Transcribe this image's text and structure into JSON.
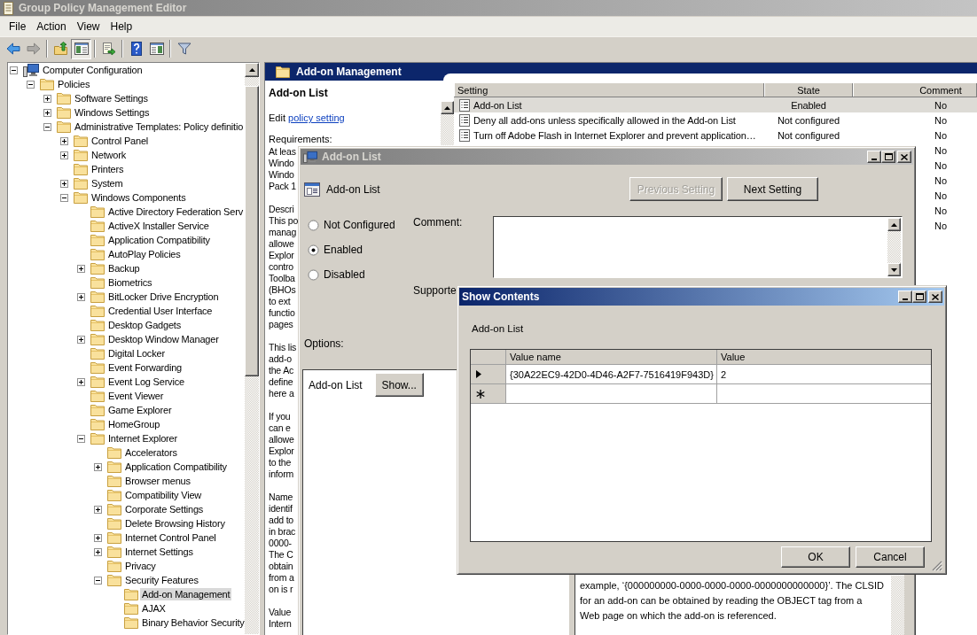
{
  "window": {
    "title": "Group Policy Management Editor",
    "active": false
  },
  "menu": [
    "File",
    "Action",
    "View",
    "Help"
  ],
  "toolbar": [
    {
      "kind": "back",
      "disabled": false,
      "pressed": false
    },
    {
      "kind": "forward",
      "disabled": true,
      "pressed": false
    },
    {
      "kind": "separator"
    },
    {
      "kind": "up",
      "disabled": false,
      "pressed": false
    },
    {
      "kind": "console_tree",
      "disabled": false,
      "pressed": true
    },
    {
      "kind": "separator"
    },
    {
      "kind": "export",
      "disabled": false,
      "pressed": false
    },
    {
      "kind": "separator"
    },
    {
      "kind": "help",
      "disabled": false,
      "pressed": false
    },
    {
      "kind": "action_pane",
      "disabled": false,
      "pressed": false
    },
    {
      "kind": "separator"
    },
    {
      "kind": "filter",
      "disabled": false,
      "pressed": false
    }
  ],
  "tree": [
    {
      "label": "Computer Configuration",
      "kind": "computer",
      "expanded": true,
      "selected": false,
      "children": [
        {
          "label": "Policies",
          "expanded": true,
          "selected": false,
          "children": [
            {
              "label": "Software Settings",
              "expanded": false,
              "selected": false
            },
            {
              "label": "Windows Settings",
              "expanded": false,
              "selected": false
            },
            {
              "label": "Administrative Templates: Policy definitio",
              "expanded": true,
              "selected": false,
              "children": [
                {
                  "label": "Control Panel",
                  "expanded": false,
                  "selected": false
                },
                {
                  "label": "Network",
                  "expanded": false,
                  "selected": false
                },
                {
                  "label": "Printers",
                  "selected": false
                },
                {
                  "label": "System",
                  "expanded": false,
                  "selected": false
                },
                {
                  "label": "Windows Components",
                  "expanded": true,
                  "selected": false,
                  "children": [
                    {
                      "label": "Active Directory Federation Serv",
                      "selected": false
                    },
                    {
                      "label": "ActiveX Installer Service",
                      "selected": false
                    },
                    {
                      "label": "Application Compatibility",
                      "selected": false
                    },
                    {
                      "label": "AutoPlay Policies",
                      "selected": false
                    },
                    {
                      "label": "Backup",
                      "expanded": false,
                      "selected": false
                    },
                    {
                      "label": "Biometrics",
                      "selected": false
                    },
                    {
                      "label": "BitLocker Drive Encryption",
                      "expanded": false,
                      "selected": false
                    },
                    {
                      "label": "Credential User Interface",
                      "selected": false
                    },
                    {
                      "label": "Desktop Gadgets",
                      "selected": false
                    },
                    {
                      "label": "Desktop Window Manager",
                      "expanded": false,
                      "selected": false
                    },
                    {
                      "label": "Digital Locker",
                      "selected": false
                    },
                    {
                      "label": "Event Forwarding",
                      "selected": false
                    },
                    {
                      "label": "Event Log Service",
                      "expanded": false,
                      "selected": false
                    },
                    {
                      "label": "Event Viewer",
                      "selected": false
                    },
                    {
                      "label": "Game Explorer",
                      "selected": false
                    },
                    {
                      "label": "HomeGroup",
                      "selected": false
                    },
                    {
                      "label": "Internet Explorer",
                      "expanded": true,
                      "selected": false,
                      "children": [
                        {
                          "label": "Accelerators",
                          "selected": false
                        },
                        {
                          "label": "Application Compatibility",
                          "expanded": false,
                          "selected": false
                        },
                        {
                          "label": "Browser menus",
                          "selected": false
                        },
                        {
                          "label": "Compatibility View",
                          "selected": false
                        },
                        {
                          "label": "Corporate Settings",
                          "expanded": false,
                          "selected": false
                        },
                        {
                          "label": "Delete Browsing History",
                          "selected": false
                        },
                        {
                          "label": "Internet Control Panel",
                          "expanded": false,
                          "selected": false
                        },
                        {
                          "label": "Internet Settings",
                          "expanded": false,
                          "selected": false
                        },
                        {
                          "label": "Privacy",
                          "selected": false
                        },
                        {
                          "label": "Security Features",
                          "expanded": true,
                          "selected": false,
                          "children": [
                            {
                              "label": "Add-on Management",
                              "selected": true
                            },
                            {
                              "label": "AJAX",
                              "selected": false
                            },
                            {
                              "label": "Binary Behavior Security",
                              "selected": false
                            }
                          ]
                        }
                      ]
                    }
                  ]
                }
              ]
            }
          ]
        }
      ]
    }
  ],
  "details": {
    "header": "Add-on Management",
    "description": {
      "title": "Add-on List",
      "edit_prefix": "Edit",
      "edit_link": "policy setting",
      "requirements_label": "Requirements:",
      "paragraphs": [
        [
          "At leas",
          "Windo",
          "Windo",
          "Pack 1"
        ],
        [
          "Descri",
          "This po",
          "manag",
          "allowe",
          "Explor",
          "contro",
          "Toolba",
          "(BHOs",
          "to ext",
          "functio",
          "pages"
        ],
        [
          "This lis",
          "add-o",
          "the Ac",
          "define",
          "here a"
        ],
        [
          "If you",
          "can e",
          "allowe",
          "Explor",
          "to the",
          "inform"
        ],
        [
          "Name",
          "identif",
          "add to",
          "in brac",
          "0000-",
          "The C",
          "obtain",
          "from a",
          "on is r"
        ],
        [
          "Value",
          "Intern"
        ]
      ]
    },
    "settings_table": {
      "columns": [
        "Setting",
        "State",
        "Comment"
      ],
      "rows": [
        {
          "setting": "Add-on List",
          "state": "Enabled",
          "comment": "No",
          "selected": true
        },
        {
          "setting": "Deny all add-ons unless specifically allowed in the Add-on List",
          "state": "Not configured",
          "comment": "No",
          "selected": false
        },
        {
          "setting": "Turn off Adobe Flash in Internet Explorer and prevent application…",
          "state": "Not configured",
          "comment": "No",
          "selected": false
        },
        {
          "comment": "No",
          "selected": false
        },
        {
          "comment": "No",
          "selected": false
        },
        {
          "comment": "No",
          "selected": false
        },
        {
          "comment": "No",
          "selected": false
        },
        {
          "comment": "No",
          "selected": false
        },
        {
          "comment": "No",
          "selected": false
        }
      ]
    }
  },
  "policy_dialog": {
    "title": "Add-on List",
    "active": false,
    "heading": "Add-on List",
    "nav_buttons": [
      {
        "label": "Previous Setting",
        "disabled": true
      },
      {
        "label": "Next Setting",
        "disabled": false
      }
    ],
    "states": [
      {
        "label": "Not Configured",
        "selected": false
      },
      {
        "label": "Enabled",
        "selected": true
      },
      {
        "label": "Disabled",
        "selected": false
      }
    ],
    "comment_label": "Comment:",
    "supported_label": "Supporte",
    "options_label": "Options:",
    "options": [
      {
        "label": "Add-on List",
        "button": "Show..."
      }
    ],
    "help_lines": [
      "example, ‘{000000000-0000-0000-0000-0000000000000}’. The CLSID",
      "for an add-on can be obtained by reading the OBJECT tag from a",
      "Web page on which the add-on is referenced."
    ]
  },
  "show_contents": {
    "title": "Show Contents",
    "active": true,
    "label": "Add-on List",
    "columns": [
      "Value name",
      "Value"
    ],
    "rows": [
      {
        "kind": "current",
        "value_name": "{30A22EC9-42D0-4D46-A2F7-7516419F943D}",
        "value": "2"
      },
      {
        "kind": "new"
      }
    ],
    "buttons": [
      "OK",
      "Cancel"
    ]
  }
}
